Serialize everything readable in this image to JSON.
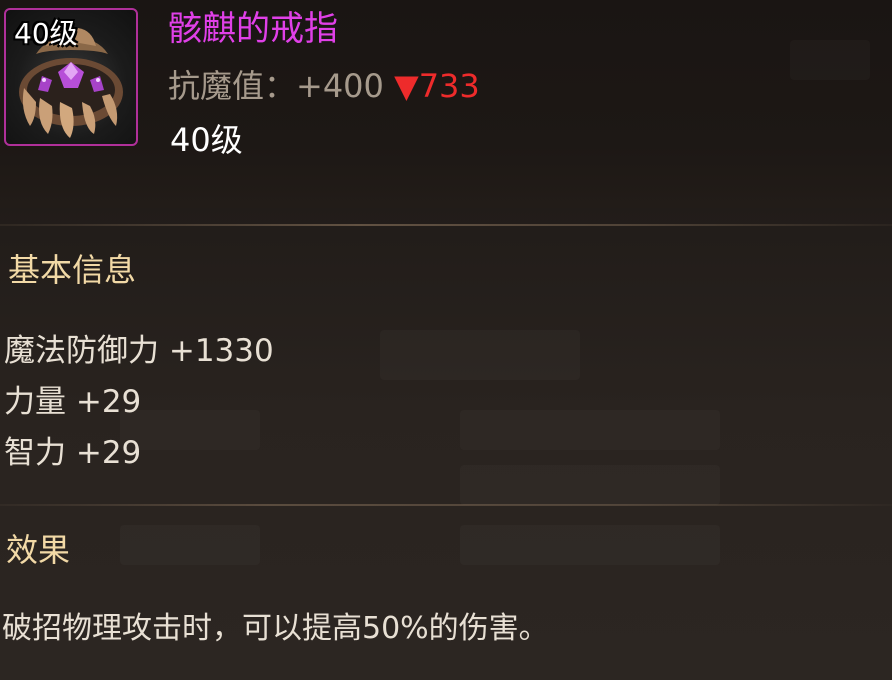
{
  "item": {
    "icon_level": "40级",
    "name": "骸麒的戒指",
    "name_color": "#e040e8",
    "rarity_border_color": "#b0309a",
    "stat_label": "抗魔值：+400",
    "stat_diff": "▼733",
    "level": "40级",
    "icon": "ring-icon"
  },
  "basic_info": {
    "title": "基本信息",
    "attributes": [
      "魔法防御力 +1330",
      "力量 +29",
      "智力 +29"
    ]
  },
  "effect": {
    "title": "效果",
    "description": "破招物理攻击时，可以提高50%的伤害。"
  }
}
